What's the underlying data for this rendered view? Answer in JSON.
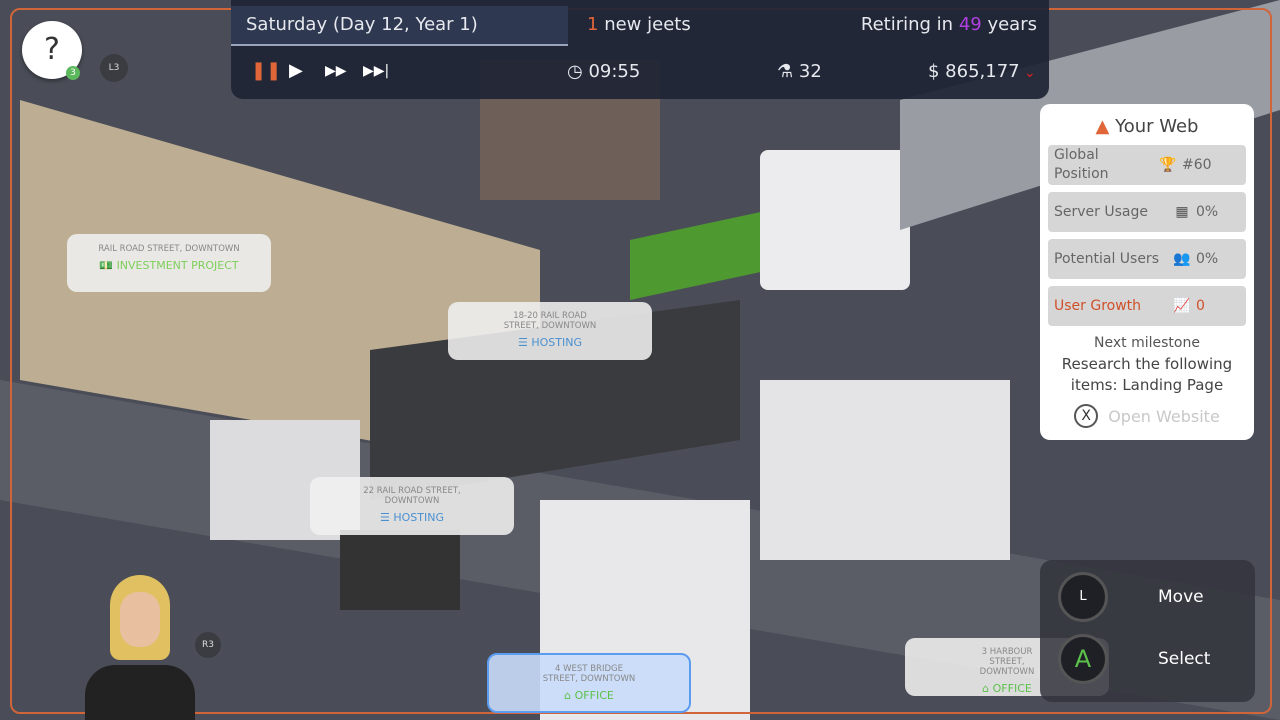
{
  "topbar": {
    "date": "Saturday (Day 12, Year 1)",
    "jeets_count": "1",
    "jeets_label": "new jeets",
    "retiring_prefix": "Retiring in",
    "retiring_years": "49",
    "retiring_suffix": "years",
    "time": "09:55",
    "research": "32",
    "money": "$ 865,177"
  },
  "controls": {
    "pause": "pause",
    "play": "play",
    "fast": "fast-forward",
    "fastest": "skip"
  },
  "help": {
    "icon": "?",
    "badge": "3",
    "l3": "L3",
    "r3": "R3"
  },
  "panel": {
    "title": "Your Web",
    "rows": [
      {
        "label": "Global Position",
        "value": "#60",
        "icon": "trophy"
      },
      {
        "label": "Server Usage",
        "value": "0%",
        "icon": "grid"
      },
      {
        "label": "Potential Users",
        "value": "0%",
        "icon": "users"
      },
      {
        "label": "User Growth",
        "value": "0",
        "icon": "chart"
      }
    ],
    "milestone_title": "Next milestone",
    "milestone_text": "Research the following items: Landing Page",
    "open_key": "X",
    "open_label": "Open Website"
  },
  "tags": [
    {
      "address": "RAIL ROAD STREET, DOWNTOWN",
      "kind": "INVESTMENT PROJECT",
      "color": "#7ccf5a"
    },
    {
      "address": "18-20 RAIL ROAD STREET, DOWNTOWN",
      "kind": "HOSTING",
      "color": "#4a90d0"
    },
    {
      "address": "22 RAIL ROAD STREET, DOWNTOWN",
      "kind": "HOSTING",
      "color": "#4a90d0"
    },
    {
      "address": "4 WEST BRIDGE STREET, DOWNTOWN",
      "kind": "OFFICE",
      "color": "#5cc04a"
    },
    {
      "address": "3 HARBOUR STREET, DOWNTOWN",
      "kind": "OFFICE",
      "color": "#5cc04a"
    }
  ],
  "pad": {
    "move_key": "L",
    "move": "Move",
    "select_key": "A",
    "select": "Select"
  },
  "colors": {
    "accent": "#e0663a",
    "purple": "#b040e0",
    "growth": "#d0502a"
  }
}
